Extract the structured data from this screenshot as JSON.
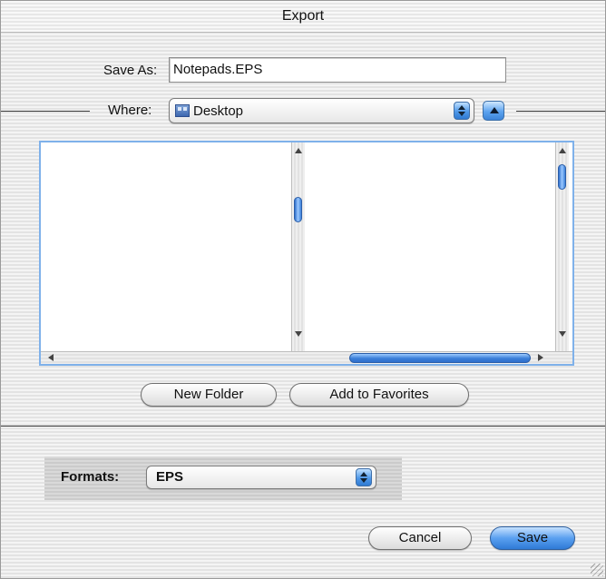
{
  "window": {
    "title": "Export"
  },
  "save_as": {
    "label": "Save As:",
    "value": "Notepads.EPS"
  },
  "where": {
    "label": "Where:",
    "value": "Desktop",
    "icon": "desktop-folder-icon"
  },
  "buttons": {
    "new_folder": "New Folder",
    "add_to_favorites": "Add to Favorites",
    "cancel": "Cancel",
    "save": "Save"
  },
  "formats": {
    "label": "Formats:",
    "value": "EPS"
  },
  "colors": {
    "accent": "#4f98e8",
    "browser_border": "#7fb1ea"
  }
}
